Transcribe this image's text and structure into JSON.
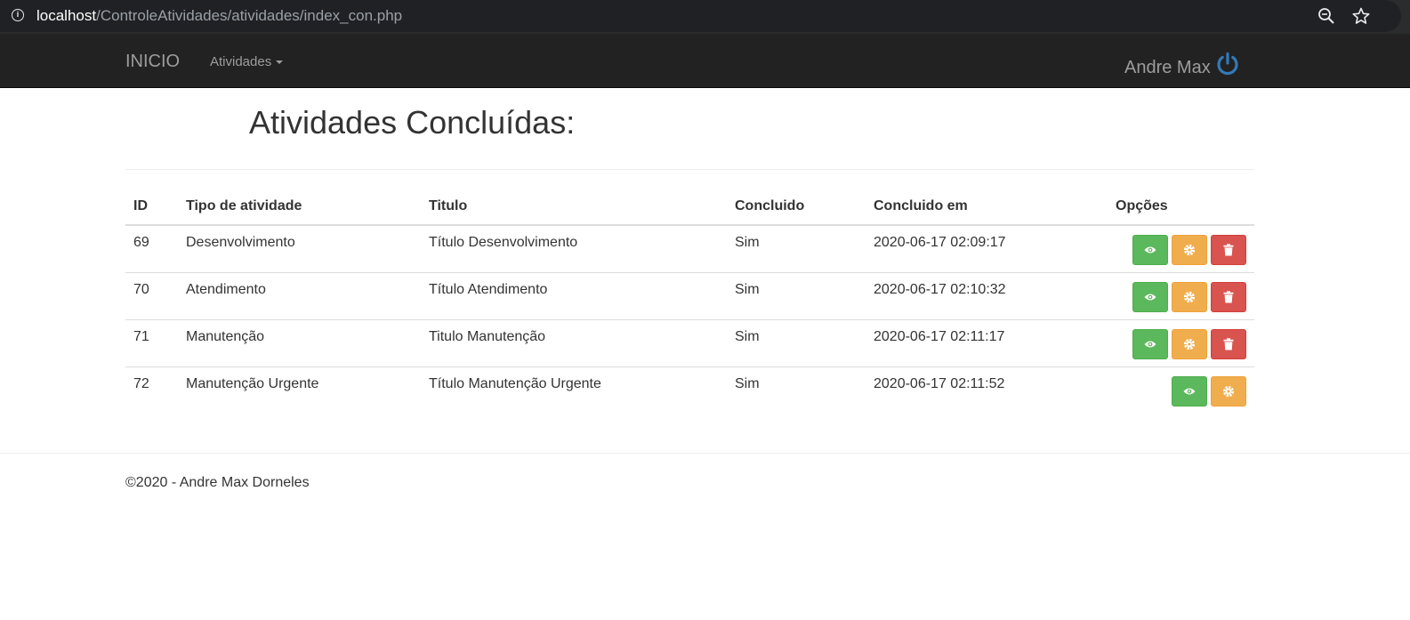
{
  "browser": {
    "url_host": "localhost",
    "url_path": "/ControleAtividades/atividades/index_con.php"
  },
  "navbar": {
    "brand": "INICIO",
    "menu_atividades": "Atividades",
    "user_name": "Andre Max"
  },
  "page": {
    "title": "Atividades Concluídas:"
  },
  "table": {
    "headers": {
      "id": "ID",
      "tipo": "Tipo de atividade",
      "titulo": "Titulo",
      "concluido": "Concluido",
      "concluido_em": "Concluido em",
      "opcoes": "Opções"
    },
    "rows": [
      {
        "id": "69",
        "tipo": "Desenvolvimento",
        "titulo": "Título Desenvolvimento",
        "concluido": "Sim",
        "concluido_em": "2020-06-17 02:09:17"
      },
      {
        "id": "70",
        "tipo": "Atendimento",
        "titulo": "Título Atendimento",
        "concluido": "Sim",
        "concluido_em": "2020-06-17 02:10:32"
      },
      {
        "id": "71",
        "tipo": "Manutenção",
        "titulo": "Titulo Manutenção",
        "concluido": "Sim",
        "concluido_em": "2020-06-17 02:11:17"
      },
      {
        "id": "72",
        "tipo": "Manutenção Urgente",
        "titulo": "Título Manutenção Urgente",
        "concluido": "Sim",
        "concluido_em": "2020-06-17 02:11:52"
      }
    ]
  },
  "footer": {
    "text": "©2020 - Andre Max Dorneles"
  },
  "icons": {
    "view": "eye-icon",
    "edit": "gear-icon",
    "delete": "trash-icon",
    "logout": "power-icon"
  },
  "colors": {
    "navbar_bg": "#222222",
    "view_button": "#5cb85c",
    "edit_button": "#f0ad4e",
    "delete_button": "#d9534f",
    "power_icon": "#337ab7"
  }
}
